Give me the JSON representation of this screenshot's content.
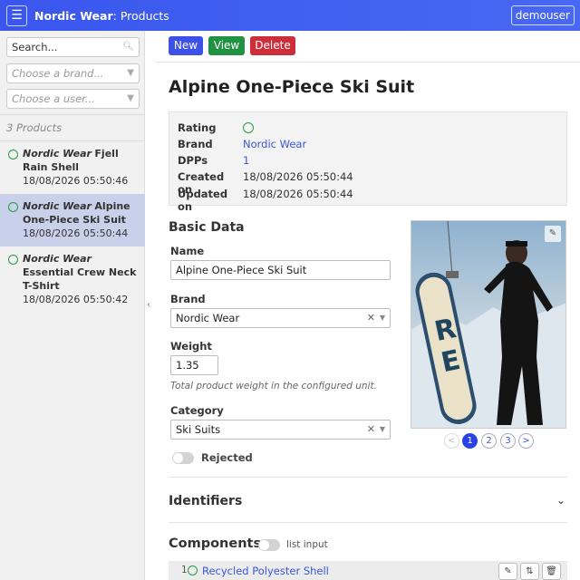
{
  "header": {
    "brand": "Nordic Wear",
    "page": "Products",
    "user": "demouser"
  },
  "sidebar": {
    "search_placeholder": "Search...",
    "brand_placeholder": "Choose a brand...",
    "user_placeholder": "Choose a user...",
    "count": "3 Products",
    "items": [
      {
        "brand": "Nordic Wear",
        "name": "Fjell Rain Shell",
        "date": "18/08/2026 05:50:46"
      },
      {
        "brand": "Nordic Wear",
        "name": "Alpine One-Piece Ski Suit",
        "date": "18/08/2026 05:50:44"
      },
      {
        "brand": "Nordic Wear",
        "name": "Essential Crew Neck T-Shirt",
        "date": "18/08/2026 05:50:42"
      }
    ]
  },
  "toolbar": {
    "new": "New",
    "view": "View",
    "delete": "Delete"
  },
  "product": {
    "title": "Alpine One-Piece Ski Suit",
    "info": {
      "rating_label": "Rating",
      "brand_label": "Brand",
      "brand": "Nordic Wear",
      "dpps_label": "DPPs",
      "dpps": "1",
      "created_label": "Created on",
      "created": "18/08/2026 05:50:44",
      "updated_label": "Updated on",
      "updated": "18/08/2026 05:50:44"
    }
  },
  "basic": {
    "title": "Basic Data",
    "name_label": "Name",
    "name": "Alpine One-Piece Ski Suit",
    "brand_label": "Brand",
    "brand": "Nordic Wear",
    "weight_label": "Weight",
    "weight": "1.35",
    "weight_hint": "Total product weight in the configured unit.",
    "category_label": "Category",
    "category": "Ski Suits",
    "rejected_label": "Rejected"
  },
  "gallery": {
    "pages": [
      "<",
      "1",
      "2",
      "3",
      ">"
    ],
    "active_page": "1"
  },
  "identifiers": {
    "title": "Identifiers"
  },
  "components": {
    "title": "Components",
    "toggle_label": "list input",
    "rows": [
      {
        "num": "1",
        "name": "Recycled Polyester Shell"
      }
    ]
  },
  "colors": {
    "header": "#3a56ee",
    "new": "#3d51e8",
    "view": "#219142",
    "delete": "#cd2e3a",
    "link": "#3a55d9",
    "rating": "#2b9a43"
  }
}
